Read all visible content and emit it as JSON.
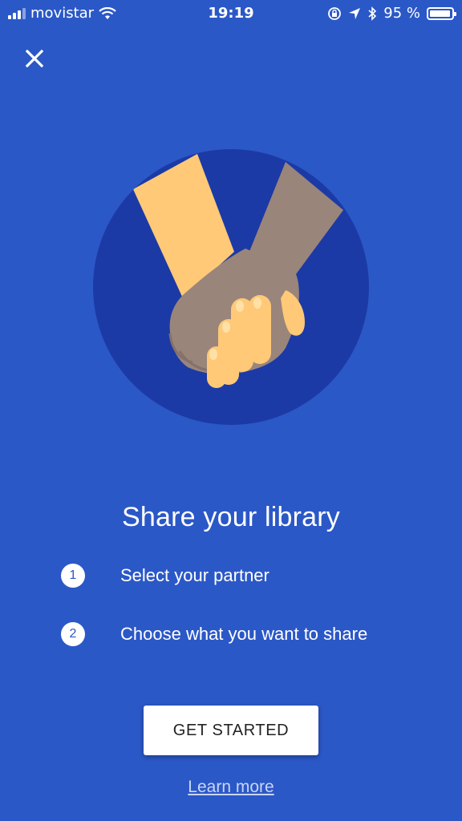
{
  "status_bar": {
    "carrier": "movistar",
    "time": "19:19",
    "battery": "95 %",
    "battery_level": 0.95,
    "icons": [
      "signal-icon",
      "wifi-icon",
      "orientation-lock-icon",
      "location-icon",
      "bluetooth-icon",
      "battery-icon"
    ]
  },
  "close": {
    "icon": "close-icon"
  },
  "illustration": {
    "name": "holding-hands-illustration",
    "colors": {
      "background": "#2b58c7",
      "circle": "#1c3aa6",
      "light_skin": "#ffc977",
      "dark_skin": "#9a857b"
    }
  },
  "content": {
    "title": "Share your library",
    "steps": [
      {
        "number": "1",
        "text": "Select your partner"
      },
      {
        "number": "2",
        "text": "Choose what you want to share"
      }
    ]
  },
  "actions": {
    "primary_label": "GET STARTED",
    "secondary_label": "Learn more"
  }
}
